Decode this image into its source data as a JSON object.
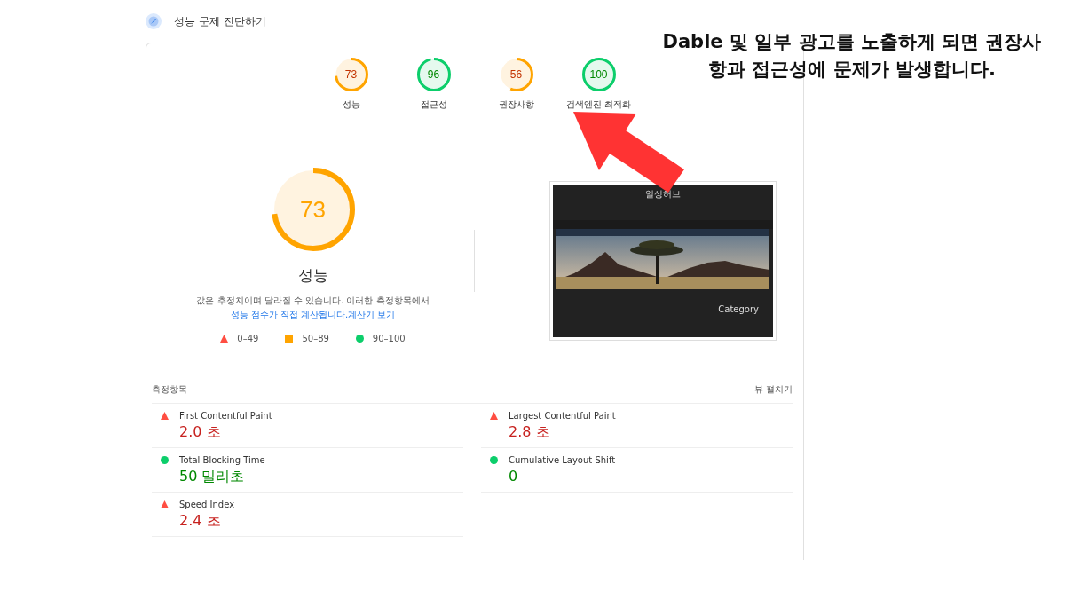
{
  "header": {
    "title": "성능 문제 진단하기"
  },
  "categories": [
    {
      "score": "73",
      "label": "성능",
      "kind": "average"
    },
    {
      "score": "96",
      "label": "접근성",
      "kind": "pass"
    },
    {
      "score": "56",
      "label": "권장사항",
      "kind": "average"
    },
    {
      "score": "100",
      "label": "검색엔진 최적화",
      "kind": "pass"
    }
  ],
  "main_gauge": {
    "score": "73",
    "label": "성능",
    "kind": "average"
  },
  "note": {
    "text": "값은 추정치이며 달라질 수 있습니다. 이러한 측정항목에서",
    "link1": "성능 점수가 직접 계산됩니다.",
    "link2": "계산기 보기"
  },
  "legend": [
    {
      "kind": "fail",
      "range": "0–49"
    },
    {
      "kind": "average",
      "range": "50–89"
    },
    {
      "kind": "pass",
      "range": "90–100"
    }
  ],
  "screenshot": {
    "site_title": "일상허브",
    "sidebar_heading": "Category"
  },
  "metrics_header": {
    "title": "측정항목",
    "toggle": "뷰 펼치기"
  },
  "metrics": [
    {
      "name": "First Contentful Paint",
      "value": "2.0 초",
      "kind": "fail"
    },
    {
      "name": "Largest Contentful Paint",
      "value": "2.8 초",
      "kind": "fail"
    },
    {
      "name": "Total Blocking Time",
      "value": "50 밀리초",
      "kind": "pass"
    },
    {
      "name": "Cumulative Layout Shift",
      "value": "0",
      "kind": "pass"
    },
    {
      "name": "Speed Index",
      "value": "2.4 초",
      "kind": "fail"
    }
  ],
  "annotation": {
    "text": "Dable 및 일부 광고를 노출하게 되면 권장사항과 접근성에 문제가 발생합니다."
  }
}
